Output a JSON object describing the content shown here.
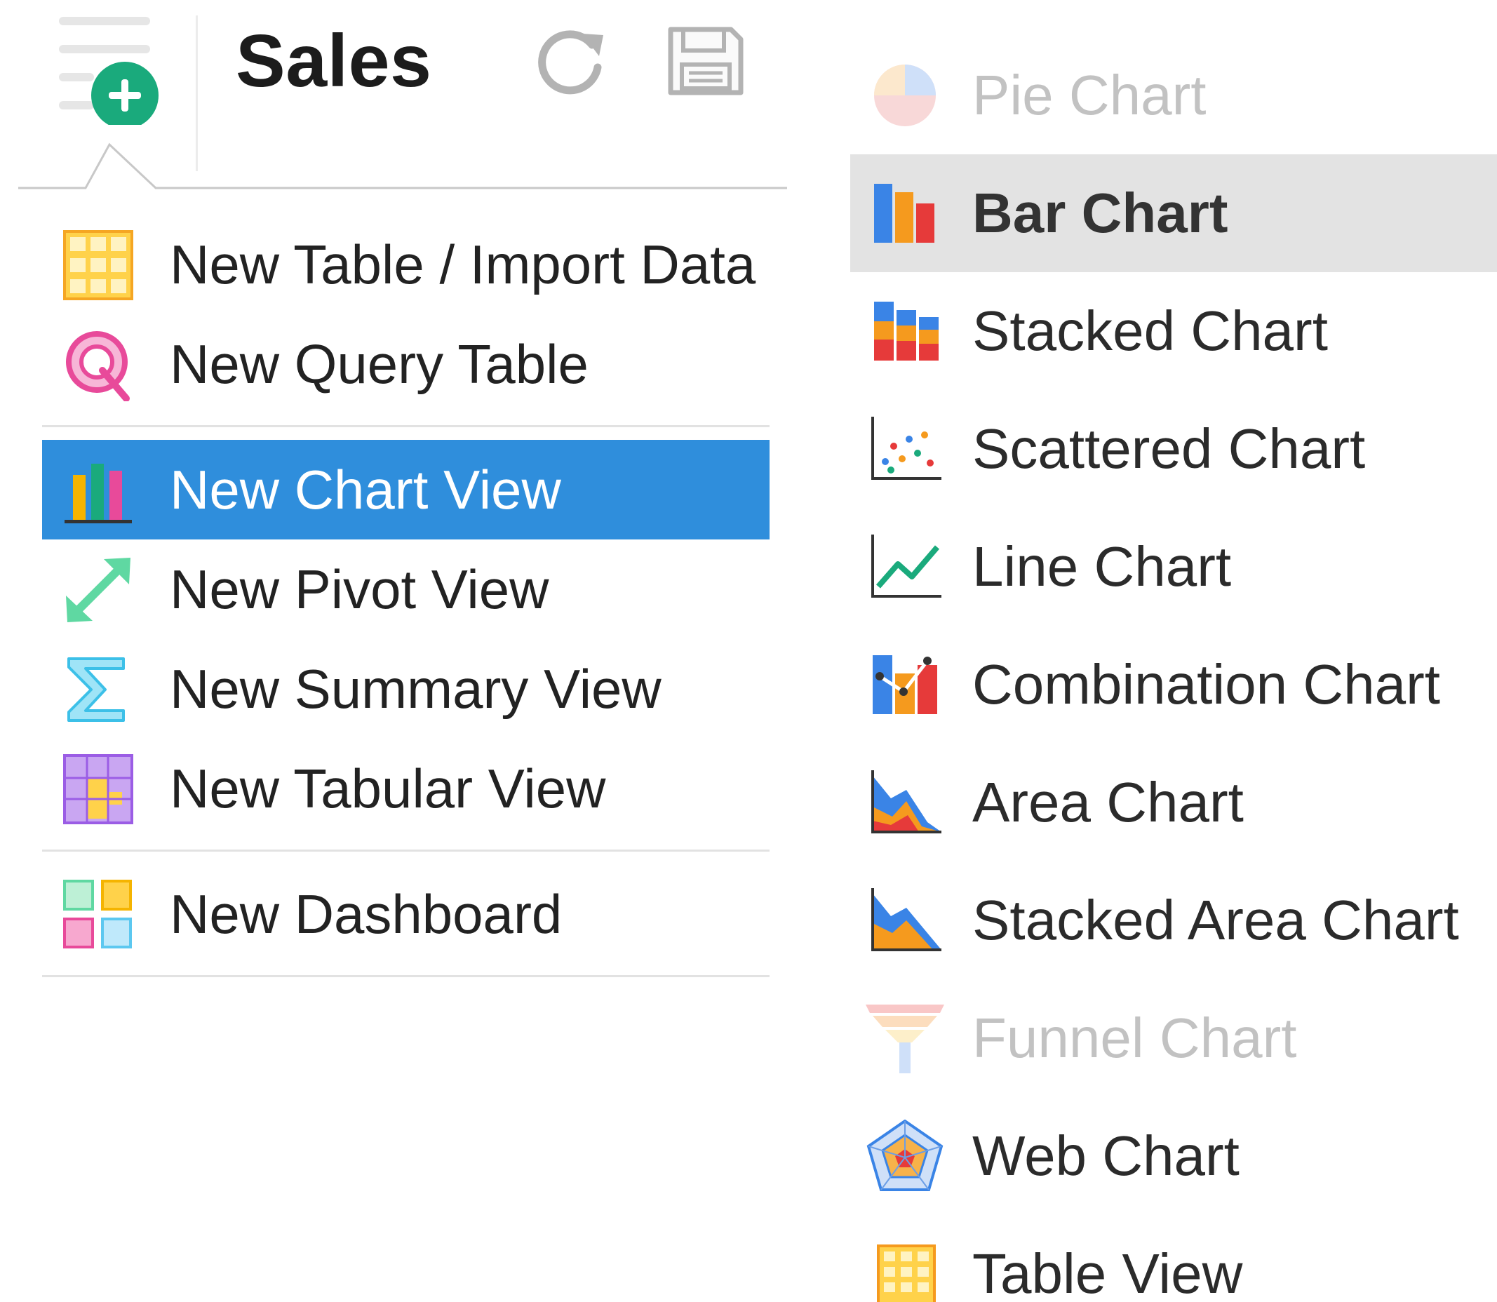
{
  "header": {
    "title": "Sales",
    "add_icon": "add-menu-icon",
    "refresh_icon": "refresh-icon",
    "save_icon": "floppy-disk-icon"
  },
  "create_menu": {
    "items": [
      {
        "label": "New Table / Import Data",
        "icon": "table-grid-icon"
      },
      {
        "label": "New Query Table",
        "icon": "query-icon"
      },
      {
        "label": "New Chart View",
        "icon": "bar-chart-icon",
        "active": true
      },
      {
        "label": "New Pivot View",
        "icon": "pivot-arrows-icon"
      },
      {
        "label": "New Summary View",
        "icon": "sigma-icon"
      },
      {
        "label": "New Tabular View",
        "icon": "tabular-grid-icon"
      },
      {
        "label": "New Dashboard",
        "icon": "dashboard-icon"
      }
    ]
  },
  "chart_menu": {
    "items": [
      {
        "label": "Pie Chart",
        "icon": "pie-chart-icon",
        "disabled": true
      },
      {
        "label": "Bar Chart",
        "icon": "bar-chart-icon",
        "hovered": true
      },
      {
        "label": "Stacked Chart",
        "icon": "stacked-bar-chart-icon"
      },
      {
        "label": "Scattered Chart",
        "icon": "scatter-chart-icon"
      },
      {
        "label": "Line Chart",
        "icon": "line-chart-icon"
      },
      {
        "label": "Combination Chart",
        "icon": "combination-chart-icon"
      },
      {
        "label": "Area Chart",
        "icon": "area-chart-icon"
      },
      {
        "label": "Stacked Area Chart",
        "icon": "stacked-area-chart-icon"
      },
      {
        "label": "Funnel Chart",
        "icon": "funnel-chart-icon",
        "disabled": true
      },
      {
        "label": "Web Chart",
        "icon": "web-chart-icon"
      },
      {
        "label": "Table View",
        "icon": "table-view-icon"
      }
    ]
  },
  "colors": {
    "active_background": "#2f8edc",
    "hover_background": "#e3e3e3",
    "add_button_green": "#1aaa7c",
    "disabled_text": "#c2c2c2"
  }
}
